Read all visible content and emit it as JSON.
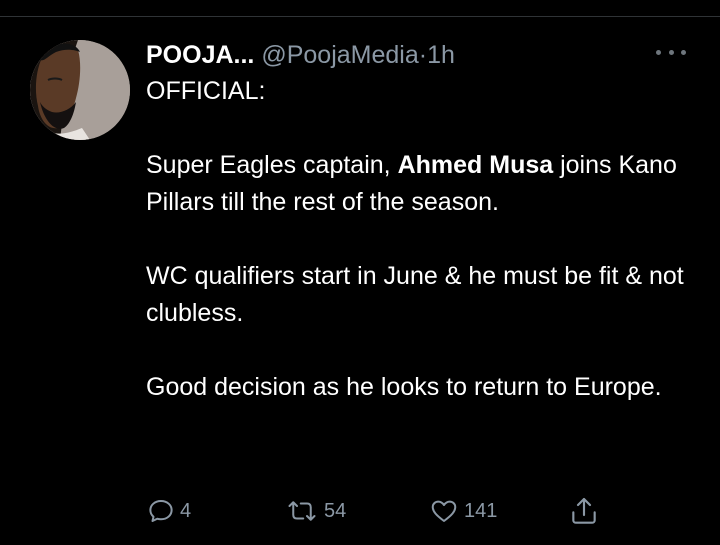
{
  "tweet": {
    "display_name": "POOJA...",
    "handle": "@PoojaMedia",
    "separator": "·",
    "time": "1h",
    "line_official": "OFFICIAL:",
    "p1_before": "Super Eagles captain, ",
    "p1_bold": "Ahmed Musa",
    "p1_after": " joins Kano Pillars till the rest of the season.",
    "p2": "WC qualifiers start in June & he must be fit & not clubless.",
    "p3": "Good decision as he looks to return to Europe."
  },
  "actions": {
    "reply_count": "4",
    "retweet_count": "54",
    "like_count": "141"
  },
  "icons": {
    "reply": "reply-icon",
    "retweet": "retweet-icon",
    "like": "heart-icon",
    "share": "share-icon",
    "more": "more-dots-icon"
  },
  "colors": {
    "background": "#000000",
    "text": "#ffffff",
    "muted": "#8b98a5"
  }
}
